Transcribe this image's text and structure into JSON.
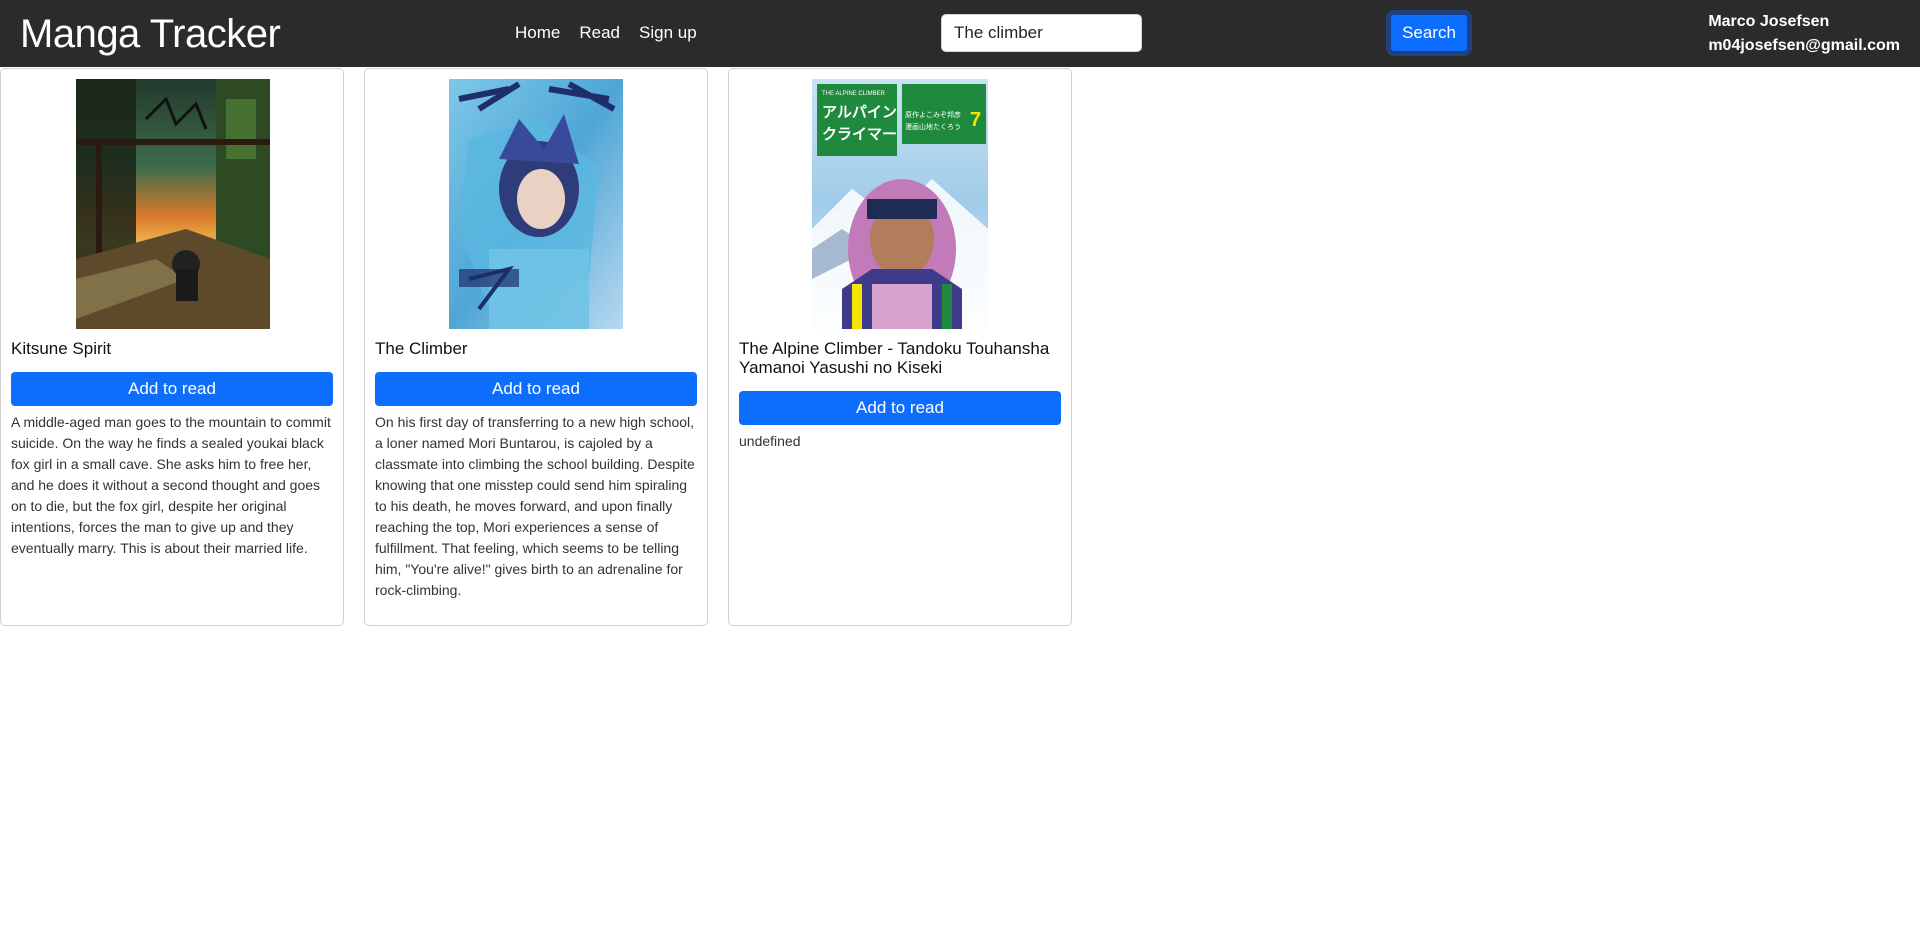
{
  "app": {
    "brand": "Manga Tracker"
  },
  "nav": {
    "links": [
      "Home",
      "Read",
      "Sign up"
    ]
  },
  "search": {
    "value": "The climber",
    "button_label": "Search"
  },
  "user": {
    "name": "Marco Josefsen",
    "email": "m04josefsen@gmail.com"
  },
  "colors": {
    "navbar": "#2b2b2b",
    "primary": "#0d6efd"
  },
  "results": [
    {
      "title": "Kitsune Spirit",
      "button_label": "Add to read",
      "description": "A middle-aged man goes to the mountain to commit suicide. On the way he finds a sealed youkai black fox girl in a small cave. She asks him to free her, and he does it without a second thought and goes on to die, but the fox girl, despite her original intentions, forces the man to give up and they eventually marry. This is about their married life."
    },
    {
      "title": "The Climber",
      "button_label": "Add to read",
      "description": "On his first day of transferring to a new high school, a loner named Mori Buntarou, is cajoled by a classmate into climbing the school building. Despite knowing that one misstep could send him spiraling to his death, he moves forward, and upon finally reaching the top, Mori experiences a sense of fulfillment. That feeling, which seems to be telling him, \"You're alive!\" gives birth to an adrenaline for rock-climbing."
    },
    {
      "title": "The Alpine Climber - Tandoku Touhansha Yamanoi Yasushi no Kiseki",
      "button_label": "Add to read",
      "description": "undefined",
      "cover_text": {
        "english": "THE ALPINE CLIMBER",
        "japanese_line1": "アルパイン",
        "japanese_line2": "クライマー",
        "authors_line1": "原作よこみぞ邦彦",
        "authors_line2": "漫画山地たくろう",
        "volume": "7"
      }
    }
  ]
}
